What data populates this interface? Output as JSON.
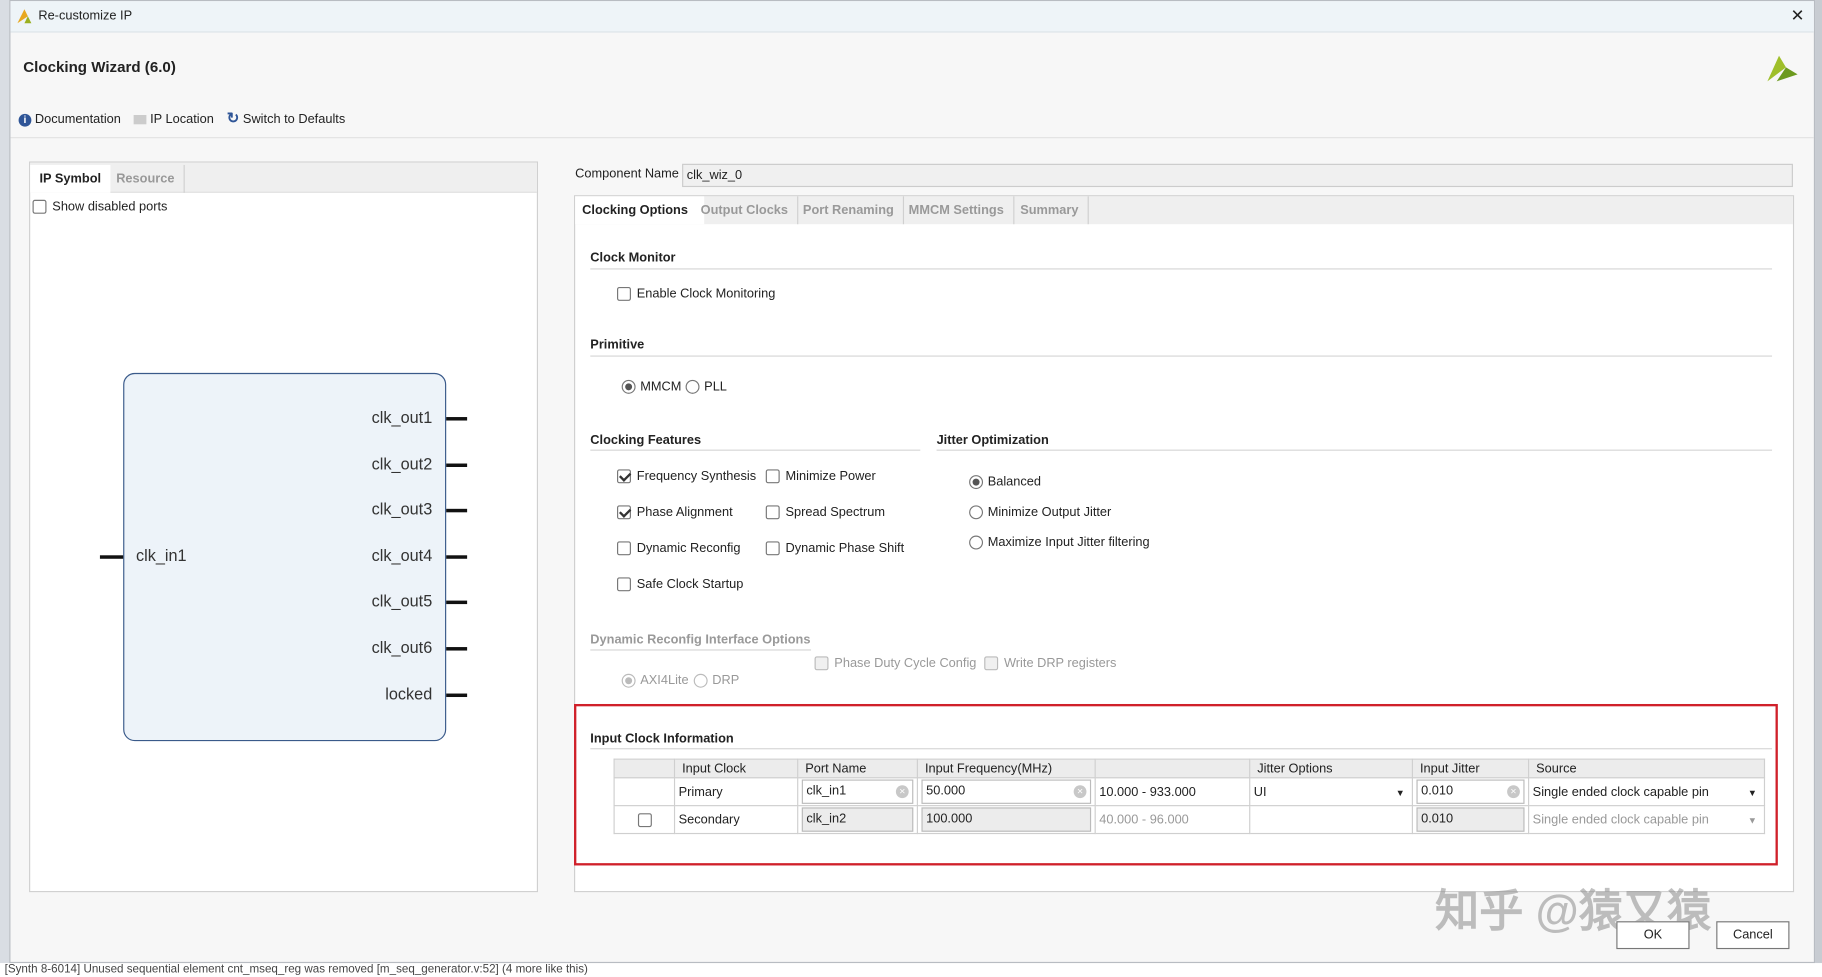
{
  "window": {
    "title": "Re-customize IP",
    "close": "✕"
  },
  "header": {
    "title": "Clocking Wizard (6.0)"
  },
  "toolbar": {
    "documentation": "Documentation",
    "ip_location": "IP Location",
    "switch_defaults": "Switch to Defaults"
  },
  "left_panel": {
    "tabs": [
      "IP Symbol",
      "Resource"
    ],
    "show_disabled_ports": "Show disabled ports",
    "symbol": {
      "input": "clk_in1",
      "outputs": [
        "clk_out1",
        "clk_out2",
        "clk_out3",
        "clk_out4",
        "clk_out5",
        "clk_out6",
        "locked"
      ]
    }
  },
  "component": {
    "label": "Component Name",
    "value": "clk_wiz_0"
  },
  "tabs": [
    "Clocking Options",
    "Output Clocks",
    "Port Renaming",
    "MMCM Settings",
    "Summary"
  ],
  "clock_monitor": {
    "title": "Clock Monitor",
    "enable": "Enable Clock Monitoring"
  },
  "primitive": {
    "title": "Primitive",
    "options": [
      "MMCM",
      "PLL"
    ],
    "selected": "MMCM"
  },
  "clocking_features": {
    "title": "Clocking Features",
    "items": [
      {
        "label": "Frequency Synthesis",
        "checked": true
      },
      {
        "label": "Minimize Power",
        "checked": false
      },
      {
        "label": "Phase Alignment",
        "checked": true
      },
      {
        "label": "Spread Spectrum",
        "checked": false
      },
      {
        "label": "Dynamic Reconfig",
        "checked": false
      },
      {
        "label": "Dynamic Phase Shift",
        "checked": false
      },
      {
        "label": "Safe Clock Startup",
        "checked": false
      }
    ]
  },
  "jitter_optimization": {
    "title": "Jitter Optimization",
    "options": [
      "Balanced",
      "Minimize Output Jitter",
      "Maximize Input Jitter filtering"
    ],
    "selected": "Balanced"
  },
  "drp": {
    "title": "Dynamic Reconfig Interface Options",
    "options": [
      "AXI4Lite",
      "DRP"
    ],
    "phase_duty": "Phase Duty Cycle Config",
    "write_drp": "Write DRP registers"
  },
  "input_clock": {
    "title": "Input Clock Information",
    "headers": [
      "",
      "Input Clock",
      "Port Name",
      "Input Frequency(MHz)",
      "",
      "Jitter Options",
      "Input Jitter",
      "Source"
    ],
    "rows": [
      {
        "clock": "Primary",
        "port": "clk_in1",
        "freq": "50.000",
        "range": "10.000 - 933.000",
        "jitter_opt": "UI",
        "jitter": "0.010",
        "source": "Single ended clock capable pin"
      },
      {
        "clock": "Secondary",
        "port": "clk_in2",
        "freq": "100.000",
        "range": "40.000 - 96.000",
        "jitter_opt": "",
        "jitter": "0.010",
        "source": "Single ended clock capable pin"
      }
    ]
  },
  "buttons": {
    "ok": "OK",
    "cancel": "Cancel"
  },
  "watermark": "知乎 @猿又猿",
  "status": "[Synth 8-6014] Unused sequential element cnt_mseq_reg was removed [m_seq_generator.v:52] (4 more like this)",
  "colors": {
    "highlight": "#d0202a",
    "symbol_border": "#3a5a8a",
    "symbol_fill": "#edf3f9"
  }
}
